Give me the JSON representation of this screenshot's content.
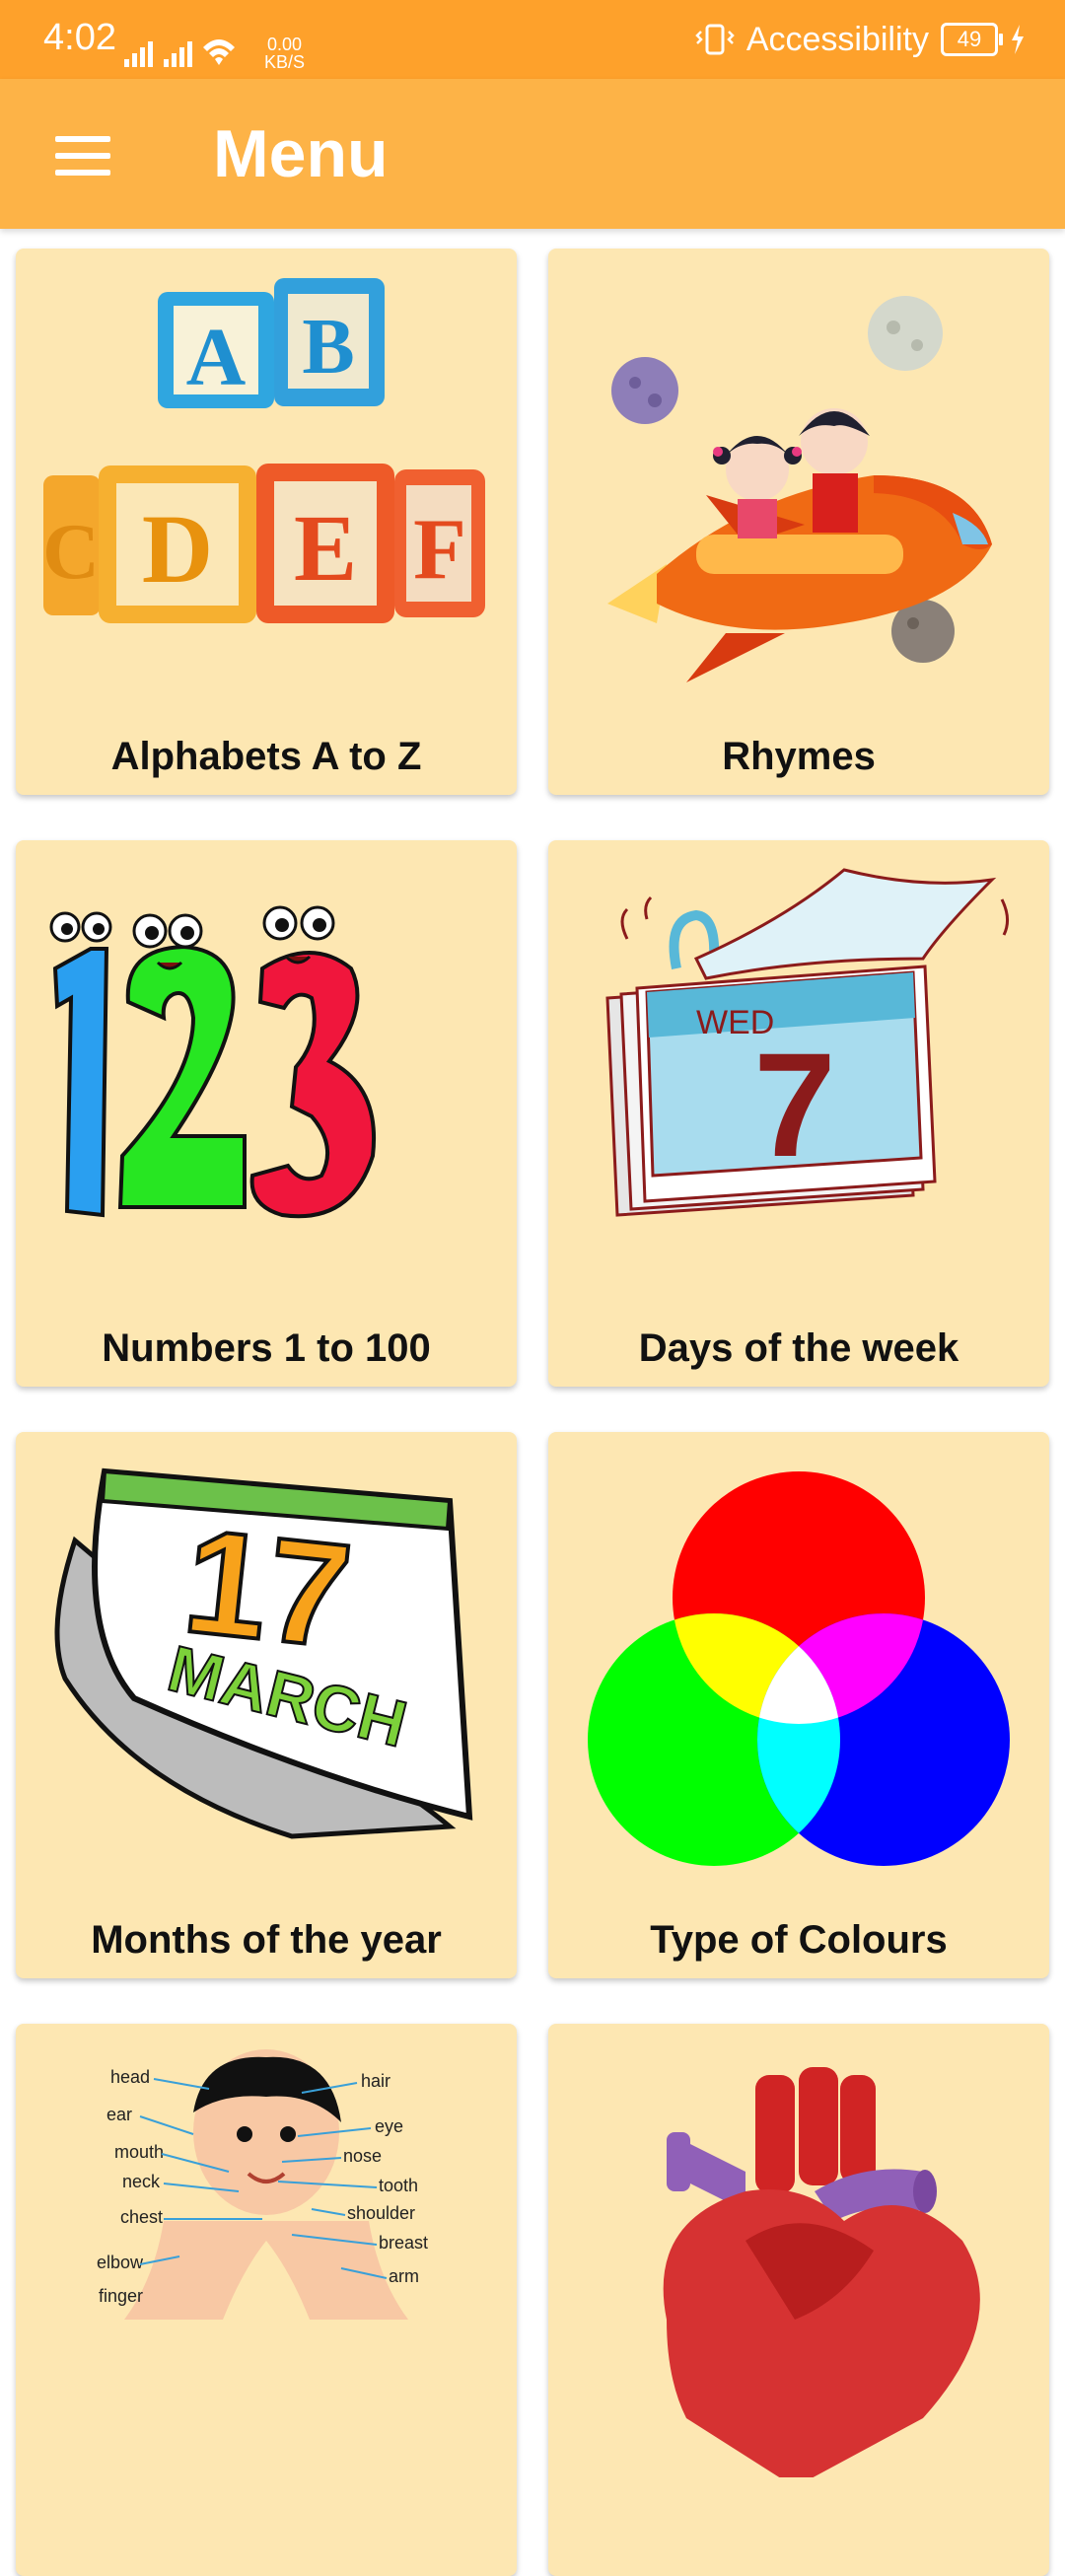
{
  "status_bar": {
    "time": "4:02",
    "speed_value": "0.00",
    "speed_unit": "KB/S",
    "accessibility_label": "Accessibility",
    "battery": "49"
  },
  "app_bar": {
    "title": "Menu",
    "menu_icon": "hamburger-menu-icon"
  },
  "cards": [
    {
      "label": "Alphabets A to Z",
      "icon": "alphabet-blocks-icon"
    },
    {
      "label": "Rhymes",
      "icon": "kids-rocket-icon"
    },
    {
      "label": "Numbers 1 to 100",
      "icon": "numbers-123-icon"
    },
    {
      "label": "Days of the week",
      "icon": "day-calendar-icon"
    },
    {
      "label": "Months of the year",
      "icon": "month-calendar-icon"
    },
    {
      "label": "Type of Colours",
      "icon": "color-circles-icon"
    },
    {
      "label": "",
      "icon": "body-parts-icon"
    },
    {
      "label": "",
      "icon": "heart-organ-icon"
    }
  ],
  "illustrations": {
    "blocks": [
      "A",
      "B",
      "C",
      "D",
      "E",
      "F"
    ],
    "calendar_day": "WED",
    "calendar_date": "7",
    "month_number": "17",
    "month_name": "MARCH",
    "body_labels_left": [
      "head",
      "ear",
      "mouth",
      "neck",
      "chest",
      "elbow",
      "finger"
    ],
    "body_labels_right": [
      "hair",
      "eye",
      "nose",
      "tooth",
      "shoulder",
      "breast",
      "arm"
    ]
  },
  "colors": {
    "status_bar": "#fea12b",
    "app_bar": "#fdb347",
    "card_bg": "#fde7b2"
  }
}
